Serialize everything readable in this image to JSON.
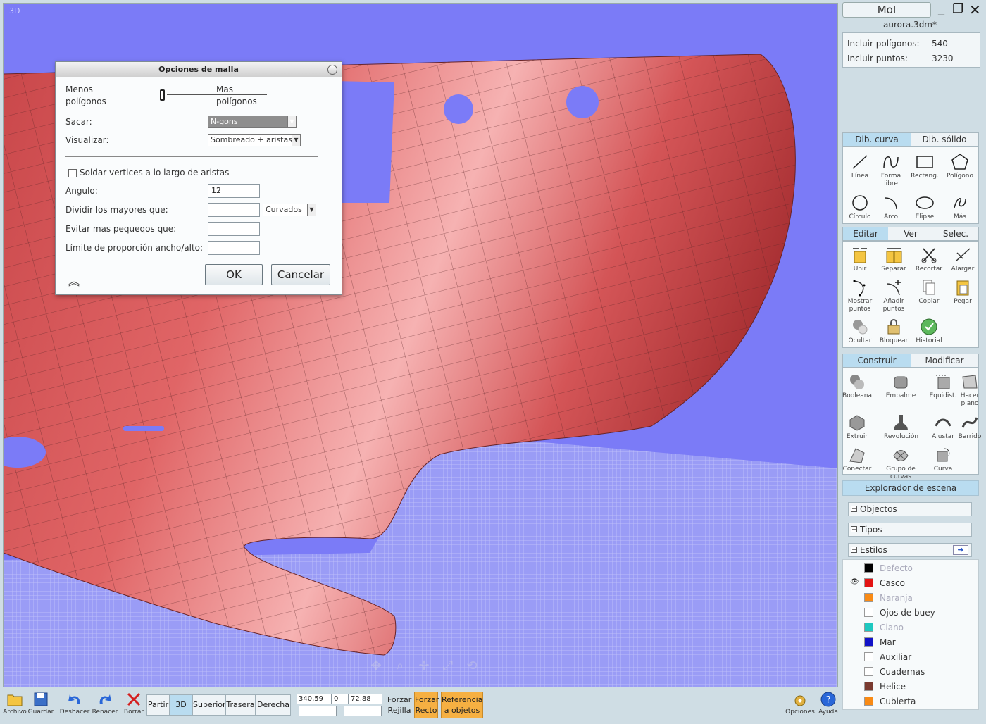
{
  "viewport": {
    "label": "3D"
  },
  "dialog": {
    "title": "Opciones de malla",
    "less_label_1": "Menos",
    "less_label_2": "polígonos",
    "more_label_1": "Mas",
    "more_label_2": "polígonos",
    "output_label": "Sacar:",
    "output_value": "N-gons",
    "display_label": "Visualizar:",
    "display_value": "Sombreado + aristas",
    "weld_label": "Soldar vertices a lo largo de aristas",
    "weld_checked": false,
    "angle_label": "Angulo:",
    "angle_value": "12",
    "divide_label": "Dividir los mayores que:",
    "divide_value": "",
    "divide_mode": "Curvados",
    "avoid_label": "Evitar mas pequeqos que:",
    "avoid_value": "",
    "ratio_label": "Límite de proporción ancho/alto:",
    "ratio_value": "",
    "ok": "OK",
    "cancel": "Cancelar"
  },
  "panel": {
    "app_title": "MoI",
    "filename": "aurora.3dm*",
    "props": [
      {
        "label": "Incluir polígonos:",
        "value": "540"
      },
      {
        "label": "Incluir puntos:",
        "value": "3230"
      }
    ],
    "draw_tabs": [
      "Dib. curva",
      "Dib. sólido"
    ],
    "draw_tools": [
      {
        "label": "Línea",
        "icon": "line-icon"
      },
      {
        "label": "Forma libre",
        "icon": "freeform-icon"
      },
      {
        "label": "Rectang.",
        "icon": "rectangle-icon"
      },
      {
        "label": "Polígono",
        "icon": "polygon-icon"
      },
      {
        "label": "Círculo",
        "icon": "circle-icon"
      },
      {
        "label": "Arco",
        "icon": "arc-icon"
      },
      {
        "label": "Elipse",
        "icon": "ellipse-icon"
      },
      {
        "label": "Más",
        "icon": "more-icon"
      }
    ],
    "edit_tabs": [
      "Editar",
      "Ver",
      "Selec."
    ],
    "edit_tools": [
      {
        "label": "Unir",
        "icon": "join-icon"
      },
      {
        "label": "Separar",
        "icon": "separate-icon"
      },
      {
        "label": "Recortar",
        "icon": "trim-icon"
      },
      {
        "label": "Alargar",
        "icon": "extend-icon"
      },
      {
        "label": "Mostrar puntos",
        "icon": "show-points-icon"
      },
      {
        "label": "Añadir puntos",
        "icon": "add-points-icon"
      },
      {
        "label": "Copiar",
        "icon": "copy-icon"
      },
      {
        "label": "Pegar",
        "icon": "paste-icon"
      },
      {
        "label": "Ocultar",
        "icon": "hide-icon"
      },
      {
        "label": "Bloquear",
        "icon": "lock-icon"
      },
      {
        "label": "Historial",
        "icon": "history-icon"
      }
    ],
    "construct_tabs": [
      "Construir",
      "Modificar"
    ],
    "construct_tools": [
      {
        "label": "Booleana",
        "icon": "boolean-icon"
      },
      {
        "label": "Empalme",
        "icon": "fillet-icon"
      },
      {
        "label": "Equidist.",
        "icon": "offset-icon"
      },
      {
        "label": "Hacer plano",
        "icon": "planar-icon"
      },
      {
        "label": "Extruir",
        "icon": "extrude-icon"
      },
      {
        "label": "Revolución",
        "icon": "revolve-icon"
      },
      {
        "label": "Ajustar",
        "icon": "sweep-fit-icon"
      },
      {
        "label": "Barrido",
        "icon": "sweep-icon"
      },
      {
        "label": "Conectar",
        "icon": "loft-icon"
      },
      {
        "label": "Grupo de curvas",
        "icon": "network-icon"
      },
      {
        "label": "Curva",
        "icon": "curve-icon"
      }
    ],
    "scene_explorer": "Explorador de escena",
    "sections": [
      "Objectos",
      "Tipos",
      "Estilos"
    ],
    "styles": [
      {
        "name": "Defecto",
        "color": "#000000",
        "dim": true,
        "visible": false
      },
      {
        "name": "Casco",
        "color": "#e31313",
        "dim": false,
        "visible": true
      },
      {
        "name": "Naranja",
        "color": "#f98a14",
        "dim": true,
        "visible": false
      },
      {
        "name": "Ojos de buey",
        "color": "#ffffff",
        "dim": false,
        "visible": false
      },
      {
        "name": "Ciano",
        "color": "#1ec8c0",
        "dim": true,
        "visible": false
      },
      {
        "name": "Mar",
        "color": "#1212c8",
        "dim": false,
        "visible": false
      },
      {
        "name": "Auxiliar",
        "color": "#ffffff",
        "dim": false,
        "visible": false
      },
      {
        "name": "Cuadernas",
        "color": "#ffffff",
        "dim": false,
        "visible": false
      },
      {
        "name": "Helice",
        "color": "#7a3a30",
        "dim": false,
        "visible": false
      },
      {
        "name": "Cubierta",
        "color": "#f98a14",
        "dim": false,
        "visible": false
      }
    ]
  },
  "bottom": {
    "file": "Archivo",
    "save": "Guardar",
    "undo": "Deshacer",
    "redo": "Renacer",
    "delete": "Borrar",
    "views": [
      "Partir",
      "3D",
      "Superior",
      "Trasera",
      "Derecha"
    ],
    "active_view": "3D",
    "coords": [
      "340,59",
      "0",
      "72,88"
    ],
    "grid_snap_1": "Forzar",
    "grid_snap_2": "Rejilla",
    "straight_snap_1": "Forzar",
    "straight_snap_2": "Recto",
    "object_snap_1": "Referencia",
    "object_snap_2": "a objetos",
    "options": "Opciones",
    "help": "Ayuda"
  },
  "colors": {
    "background": "#7b7bf7",
    "hull": "#e86a6a",
    "accent": "#b9dcf0",
    "orange": "#f6b042"
  }
}
